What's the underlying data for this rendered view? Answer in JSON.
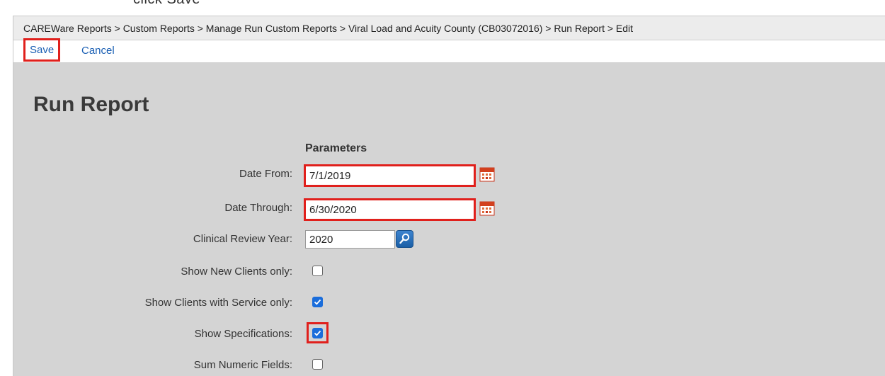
{
  "top_fragment": "click Save",
  "breadcrumb": "CAREWare Reports > Custom Reports > Manage Run Custom Reports > Viral Load and Acuity County (CB03072016) > Run Report > Edit",
  "toolbar": {
    "save_label": "Save",
    "cancel_label": "Cancel"
  },
  "page_title": "Run Report",
  "parameters": {
    "heading": "Parameters",
    "date_from": {
      "label": "Date From:",
      "value": "7/1/2019"
    },
    "date_through": {
      "label": "Date Through:",
      "value": "6/30/2020"
    },
    "clinical_review_year": {
      "label": "Clinical Review Year:",
      "value": "2020"
    },
    "show_new_clients": {
      "label": "Show New Clients only:",
      "checked": false
    },
    "show_clients_service": {
      "label": "Show Clients with Service only:",
      "checked": true
    },
    "show_specifications": {
      "label": "Show Specifications:",
      "checked": true
    },
    "sum_numeric_fields": {
      "label": "Sum Numeric Fields:",
      "checked": false
    }
  },
  "colors": {
    "link": "#1a5fb4",
    "highlight": "#e0201c",
    "checkbox_on": "#1a6ddb",
    "panel_bg": "#d4d4d4"
  }
}
